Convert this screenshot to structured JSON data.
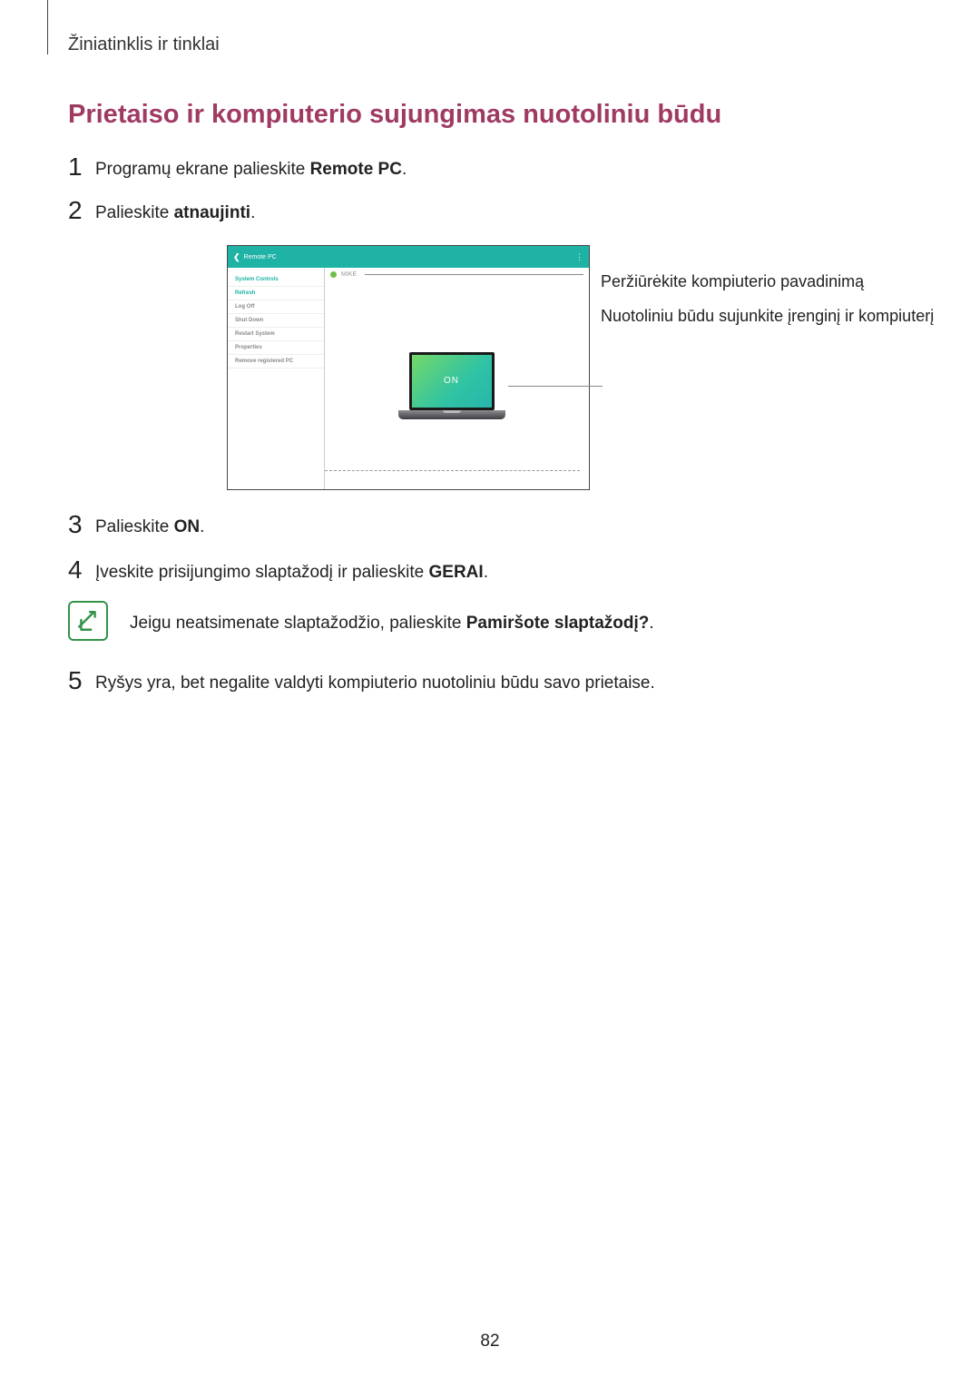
{
  "breadcrumb": "Žiniatinklis ir tinklai",
  "title": "Prietaiso ir kompiuterio sujungimas nuotoliniu būdu",
  "steps": {
    "s1": {
      "num": "1",
      "pre": "Programų ekrane palieskite ",
      "bold": "Remote PC",
      "post": "."
    },
    "s2": {
      "num": "2",
      "pre": "Palieskite ",
      "bold": "atnaujinti",
      "post": "."
    },
    "s3": {
      "num": "3",
      "pre": "Palieskite ",
      "bold": "ON",
      "post": "."
    },
    "s4": {
      "num": "4",
      "pre": "Įveskite prisijungimo slaptažodį ir palieskite ",
      "bold": "GERAI",
      "post": "."
    },
    "s5": {
      "num": "5",
      "text": "Ryšys yra, bet negalite valdyti kompiuterio nuotoliniu būdu savo prietaise."
    }
  },
  "note": {
    "pre": "Jeigu neatsimenate slaptažodžio, palieskite ",
    "bold": "Pamiršote slaptažodį?",
    "post": "."
  },
  "figure": {
    "header_title": "Remote PC",
    "pc_label": "MIKE",
    "on_badge": "ON",
    "sidebar": {
      "i0": "System Controls",
      "i1": "Refresh",
      "i2": "Log Off",
      "i3": "Shut Down",
      "i4": "Restart System",
      "i5": "Properties",
      "i6": "Remove registered PC"
    }
  },
  "callouts": {
    "c1": "Peržiūrėkite kompiuterio pavadinimą",
    "c2": "Nuotoliniu būdu sujunkite įrenginį ir kompiuterį"
  },
  "page": "82"
}
